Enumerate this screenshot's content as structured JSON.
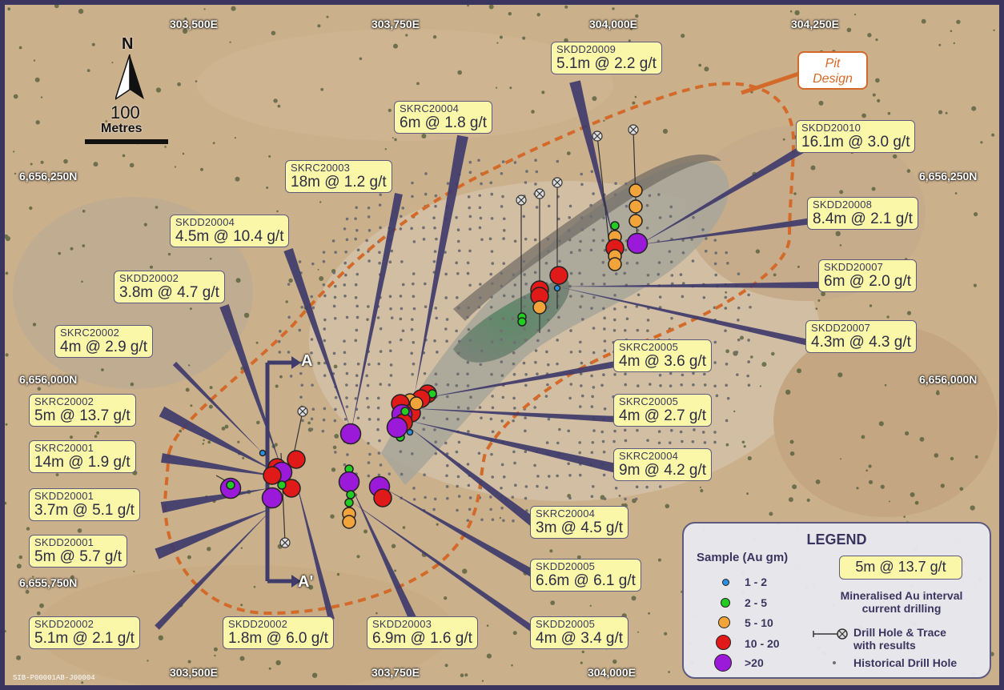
{
  "colors": {
    "frame": "#3a355f",
    "label_bg": "#fbf7a8",
    "leader": "#3f3b6b",
    "pit_outline": "#d46a2a",
    "au_1_2": "#2d8fe0",
    "au_2_5": "#22cc22",
    "au_5_10": "#f2a33a",
    "au_10_20": "#e01919",
    "au_gt_20": "#9b19d8"
  },
  "grid": {
    "top_eastings": [
      "303,500E",
      "303,750E",
      "304,000E",
      "304,250E"
    ],
    "bottom_eastings": [
      "303,500E",
      "303,750E",
      "304,000E"
    ],
    "left_northings": [
      "6,656,250N",
      "6,656,000N",
      "6,655,750N"
    ],
    "right_northings": [
      "6,656,250N",
      "6,656,000N"
    ]
  },
  "north_arrow": {
    "letter": "N",
    "scale_value": "100",
    "scale_unit": "Metres"
  },
  "section": {
    "start": "A",
    "end": "A'"
  },
  "pit_callout": {
    "line1": "Pit",
    "line2": "Design"
  },
  "intercepts": [
    {
      "hole": "SKDD20009",
      "result": "5.1m @ 2.2 g/t"
    },
    {
      "hole": "SKRC20004",
      "result": "6m @ 1.8 g/t"
    },
    {
      "hole": "SKDD20010",
      "result": "16.1m @ 3.0 g/t"
    },
    {
      "hole": "SKRC20003",
      "result": "18m @ 1.2 g/t"
    },
    {
      "hole": "SKDD20004",
      "result": "4.5m @ 10.4 g/t"
    },
    {
      "hole": "SKDD20008",
      "result": "8.4m @ 2.1 g/t"
    },
    {
      "hole": "SKDD20002",
      "result": "3.8m @ 4.7 g/t"
    },
    {
      "hole": "SKDD20007",
      "result": "6m @ 2.0 g/t"
    },
    {
      "hole": "SKRC20002",
      "result": "4m @ 2.9 g/t"
    },
    {
      "hole": "SKDD20007",
      "result": "4.3m @ 4.3 g/t"
    },
    {
      "hole": "SKRC20005",
      "result": "4m @ 3.6 g/t"
    },
    {
      "hole": "SKRC20002",
      "result": "5m @ 13.7 g/t"
    },
    {
      "hole": "SKRC20005",
      "result": "4m @ 2.7 g/t"
    },
    {
      "hole": "SKRC20001",
      "result": "14m @ 1.9 g/t"
    },
    {
      "hole": "SKRC20004",
      "result": "9m @ 4.2 g/t"
    },
    {
      "hole": "SKDD20001",
      "result": "3.7m @ 5.1 g/t"
    },
    {
      "hole": "SKRC20004",
      "result": "3m @ 4.5 g/t"
    },
    {
      "hole": "SKDD20001",
      "result": "5m @ 5.7 g/t"
    },
    {
      "hole": "SKDD20005",
      "result": "6.6m @ 6.1 g/t"
    },
    {
      "hole": "SKDD20002",
      "result": "5.1m @ 2.1 g/t"
    },
    {
      "hole": "SKDD20002",
      "result": "1.8m @ 6.0 g/t"
    },
    {
      "hole": "SKDD20003",
      "result": "6.9m @ 1.6 g/t"
    },
    {
      "hole": "SKDD20005",
      "result": "4m @ 3.4 g/t"
    }
  ],
  "legend": {
    "title": "LEGEND",
    "sample_heading": "Sample (Au gm)",
    "classes": [
      "1 - 2",
      "2 - 5",
      "5 - 10",
      "10 - 20",
      ">20"
    ],
    "example_box": "5m @ 13.7 g/t",
    "mineralised_line1": "Mineralised  Au interval",
    "mineralised_line2": "current drilling",
    "drill_trace_line1": "Drill Hole & Trace",
    "drill_trace_line2": "with results",
    "historical": "Historical Drill Hole"
  },
  "credit": "SIB-P00001AB-J00004"
}
